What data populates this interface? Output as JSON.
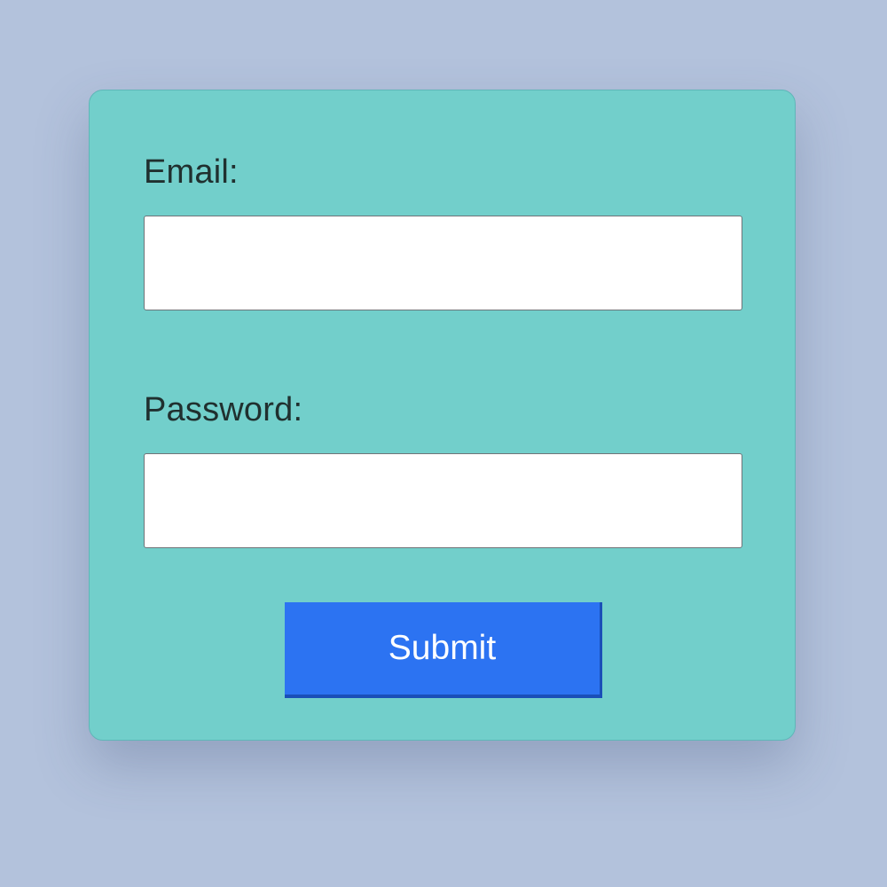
{
  "form": {
    "email_label": "Email:",
    "email_value": "",
    "password_label": "Password:",
    "password_value": "",
    "submit_label": "Submit"
  },
  "colors": {
    "page_background": "#b3c2dc",
    "card_background": "#72cfcb",
    "button_background": "#2c73f2",
    "button_text": "#ffffff",
    "label_text": "#20302f"
  }
}
